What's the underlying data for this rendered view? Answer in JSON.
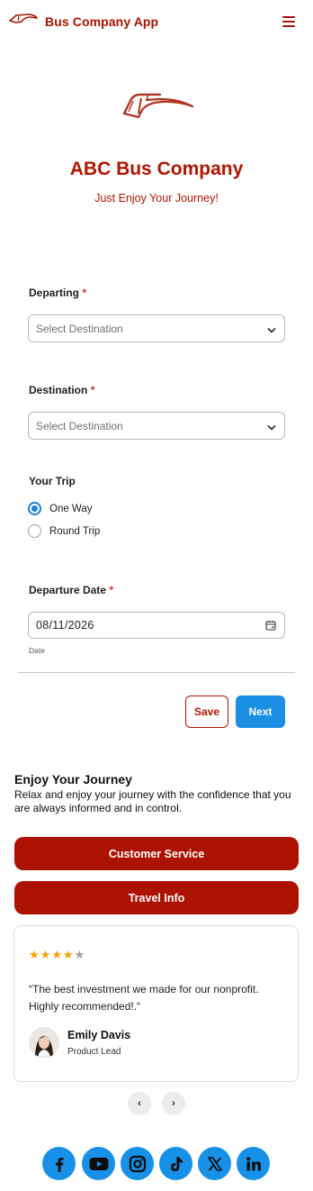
{
  "header": {
    "app_title": "Bus Company App",
    "logo_icon": "bus-logo-icon",
    "menu_icon": "hamburger-menu-icon"
  },
  "hero": {
    "company_name": "ABC Bus Company",
    "tagline": "Just Enjoy Your Journey!"
  },
  "form": {
    "departing_label": "Departing",
    "departing_placeholder": "Select Destination",
    "destination_label": "Destination",
    "destination_placeholder": "Select Destination",
    "required_mark": "*",
    "trip_label": "Your Trip",
    "trip_options": [
      {
        "label": "One Way",
        "selected": true
      },
      {
        "label": "Round Trip",
        "selected": false
      }
    ],
    "date_label": "Departure Date",
    "date_value": "08/11/2026",
    "date_hint": "Date",
    "save_label": "Save",
    "next_label": "Next"
  },
  "info": {
    "title": "Enjoy Your Journey",
    "description": "Relax and enjoy your journey with the confidence that you are always informed and in control.",
    "customer_service_label": "Customer Service",
    "travel_info_label": "Travel Info"
  },
  "testimonial": {
    "rating": 4,
    "max_rating": 5,
    "quote": "“The best investment we made for our nonprofit. Highly recommended!.“",
    "name": "Emily Davis",
    "role": "Product Lead",
    "prev_icon": "chevron-left-icon",
    "next_icon": "chevron-right-icon"
  },
  "social": [
    "facebook-icon",
    "youtube-icon",
    "instagram-icon",
    "tiktok-icon",
    "x-icon",
    "linkedin-icon"
  ],
  "colors": {
    "brand_red": "#a61300",
    "primary_blue": "#1a8fe3",
    "social_blue": "#1791e8",
    "star_gold": "#f5a300"
  }
}
